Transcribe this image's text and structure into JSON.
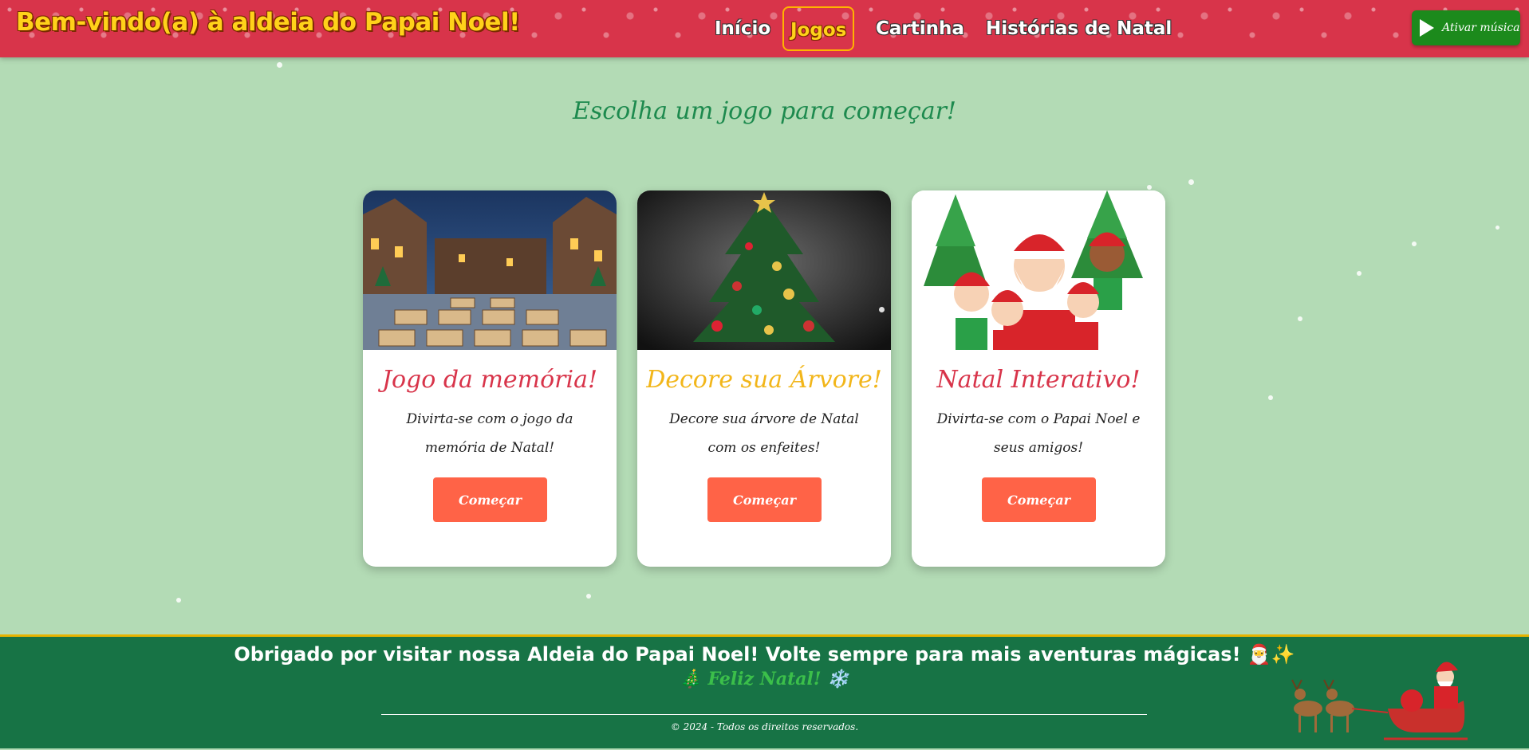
{
  "header": {
    "site_title": "Bem-vindo(a) à aldeia do Papai Noel!",
    "nav": [
      {
        "label": "Início",
        "active": false
      },
      {
        "label": "Jogos",
        "active": true
      },
      {
        "label": "Cartinha",
        "active": false
      },
      {
        "label": "Histórias de Natal",
        "active": false
      }
    ],
    "music_button": {
      "label": "Ativar música",
      "icon": "play-icon"
    }
  },
  "main": {
    "heading": "Escolha um jogo para começar!",
    "cards": [
      {
        "title": "Jogo da memória!",
        "title_color": "#d8344a",
        "description": "Divirta-se com o jogo da memória de Natal!",
        "button_label": "Começar",
        "image": "snowy-village-memory-tiles"
      },
      {
        "title": "Decore sua Árvore!",
        "title_color": "#f2b61a",
        "description": "Decore sua árvore de Natal com os enfeites!",
        "button_label": "Começar",
        "image": "christmas-tree"
      },
      {
        "title": "Natal Interativo!",
        "title_color": "#d8344a",
        "description": "Divirta-se com o Papai Noel e seus amigos!",
        "button_label": "Começar",
        "image": "santa-and-kids"
      }
    ]
  },
  "footer": {
    "message": "Obrigado por visitar nossa Aldeia do Papai Noel! Volte sempre para mais aventuras mágicas! 🎅✨",
    "greeting": "🎄 Feliz Natal! ❄️",
    "copyright": "© 2024 - Todos os direitos reservados.",
    "image": "santa-sleigh-reindeer"
  },
  "colors": {
    "header_bg": "#d8344a",
    "page_bg": "#b3dbb5",
    "footer_bg": "#177345",
    "button": "#ff6347",
    "music_button": "#1c8a1c",
    "heading": "#1d8a4e"
  }
}
